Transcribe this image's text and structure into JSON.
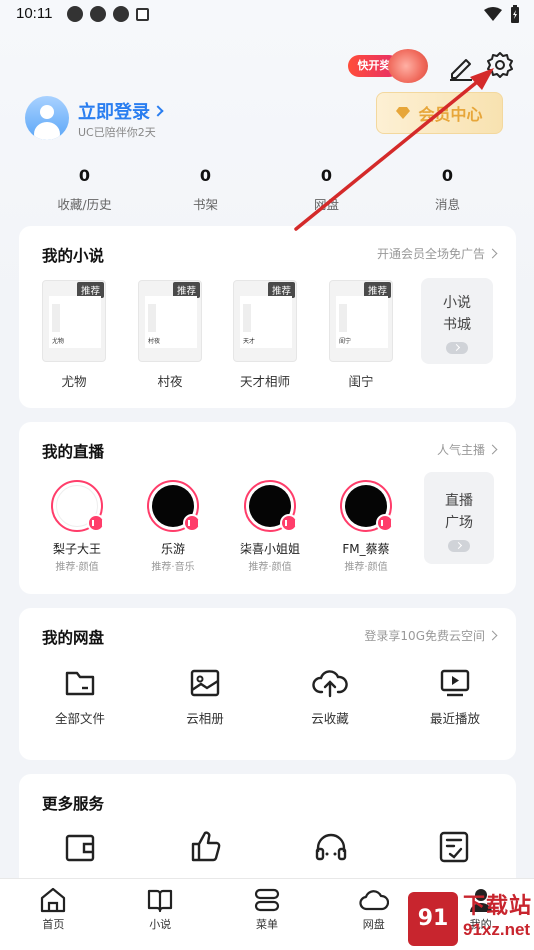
{
  "status_bar": {
    "time": "10:11",
    "left_icons": [
      "pinwheel-icon",
      "app-icon",
      "app-icon",
      "a-icon"
    ],
    "right_icons": [
      "wifi-icon",
      "battery-icon"
    ]
  },
  "header": {
    "promo_label": "快开奖",
    "edit_icon": "pen-icon",
    "settings_icon": "gear-icon",
    "login_title": "立即登录",
    "login_subtitle": "UC已陪伴你2天",
    "vip_label": "会员中心"
  },
  "stats": [
    {
      "value": "0",
      "label": "收藏/历史"
    },
    {
      "value": "0",
      "label": "书架"
    },
    {
      "value": "0",
      "label": "网盘"
    },
    {
      "value": "0",
      "label": "消息"
    }
  ],
  "novels": {
    "title": "我的小说",
    "more": "开通会员全场免广告",
    "tag": "推荐",
    "items": [
      {
        "name": "尤物",
        "cover_text": "尤物"
      },
      {
        "name": "村夜",
        "cover_text": "村夜"
      },
      {
        "name": "天才相师",
        "cover_text": "天才"
      },
      {
        "name": "闺宁",
        "cover_text": "闺宁"
      }
    ],
    "side": {
      "line1": "小说",
      "line2": "书城"
    }
  },
  "live": {
    "title": "我的直播",
    "more": "人气主播",
    "items": [
      {
        "name": "梨子大王",
        "sub": "推荐·颜值"
      },
      {
        "name": "乐游",
        "sub": "推荐·音乐"
      },
      {
        "name": "柒喜小姐姐",
        "sub": "推荐·颜值"
      },
      {
        "name": "FM_蔡蔡",
        "sub": "推荐·颜值"
      }
    ],
    "side": {
      "line1": "直播",
      "line2": "广场"
    }
  },
  "disk": {
    "title": "我的网盘",
    "more": "登录享10G免费云空间",
    "items": [
      {
        "name": "全部文件",
        "icon": "folder-icon"
      },
      {
        "name": "云相册",
        "icon": "image-icon"
      },
      {
        "name": "云收藏",
        "icon": "cloud-upload-icon"
      },
      {
        "name": "最近播放",
        "icon": "play-screen-icon"
      }
    ]
  },
  "services": {
    "title": "更多服务",
    "icons": [
      "wallet-icon",
      "thumbs-up-icon",
      "headset-icon",
      "document-check-icon"
    ]
  },
  "nav": [
    {
      "label": "首页",
      "icon": "home-icon"
    },
    {
      "label": "小说",
      "icon": "book-icon"
    },
    {
      "label": "菜单",
      "icon": "menu-icon"
    },
    {
      "label": "网盘",
      "icon": "cloud-icon"
    },
    {
      "label": "我的",
      "icon": "user-icon"
    }
  ],
  "watermark": {
    "logo_text": "91",
    "big": "下载站",
    "url": "91xz.net"
  },
  "colors": {
    "accent": "#2a7ef0",
    "live_ring": "#ff3d6a",
    "vip": "#e7a63a",
    "arrow": "#d42a2a",
    "watermark": "#c8252e"
  }
}
